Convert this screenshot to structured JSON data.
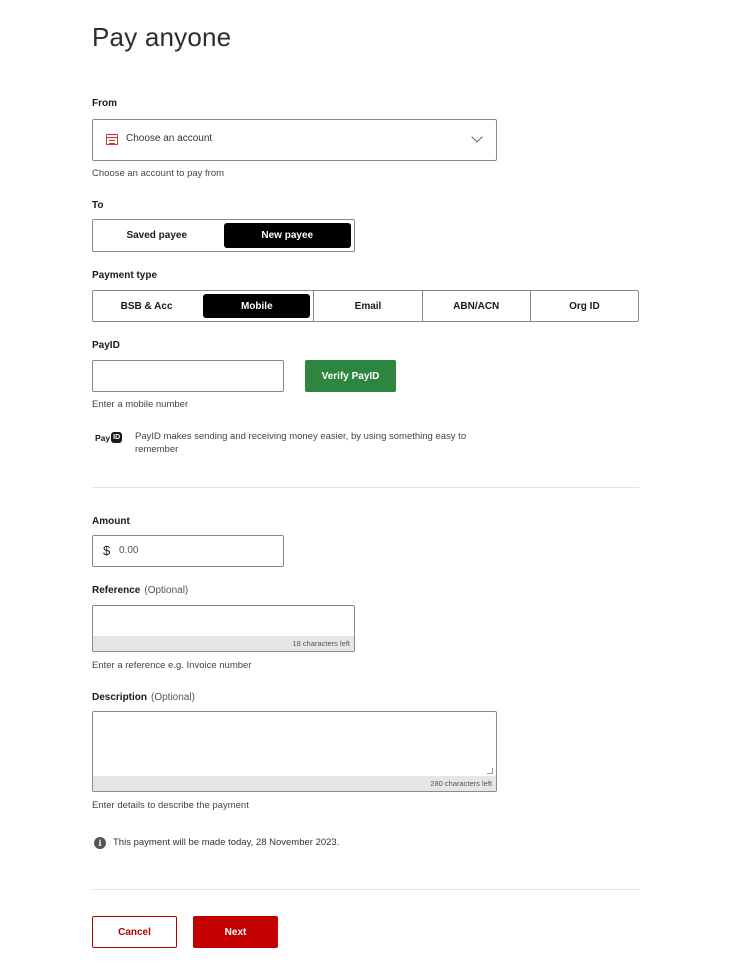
{
  "page": {
    "title": "Pay anyone"
  },
  "from": {
    "label": "From",
    "select_placeholder": "Choose an account",
    "hint": "Choose an account to pay from"
  },
  "to": {
    "label": "To",
    "options": [
      "Saved payee",
      "New payee"
    ],
    "selected": "New payee"
  },
  "payment_type": {
    "label": "Payment type",
    "options": [
      "BSB & Acc",
      "Mobile",
      "Email",
      "ABN/ACN",
      "Org ID"
    ],
    "selected": "Mobile"
  },
  "payid": {
    "label": "PayID",
    "value": "",
    "verify_label": "Verify PayID",
    "hint": "Enter a mobile number",
    "logo_text": "Pay",
    "logo_badge": "ID",
    "info": "PayID makes sending and receiving money easier, by using something easy to remember"
  },
  "amount": {
    "label": "Amount",
    "currency_symbol": "$",
    "placeholder": "0.00"
  },
  "reference": {
    "label": "Reference",
    "optional": "(Optional)",
    "counter": "18 characters left",
    "hint": "Enter a reference e.g. Invoice number"
  },
  "description": {
    "label": "Description",
    "optional": "(Optional)",
    "counter": "280 characters left",
    "hint": "Enter details to describe the payment"
  },
  "notice": {
    "text": "This payment will be made today, 28 November 2023."
  },
  "actions": {
    "cancel_label": "Cancel",
    "next_label": "Next"
  },
  "colors": {
    "primary": "#c40000",
    "verify": "#2e8540",
    "selected": "#000000"
  }
}
